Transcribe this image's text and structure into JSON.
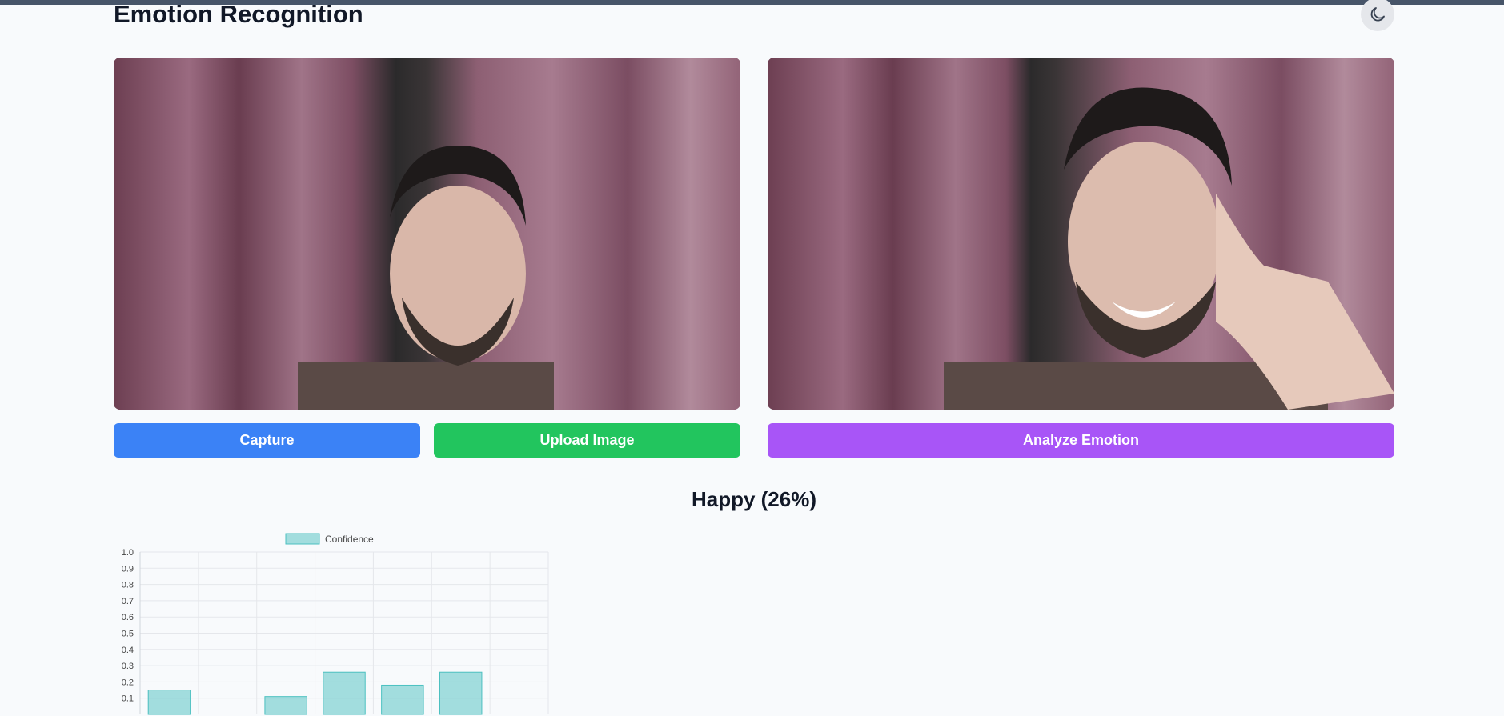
{
  "app": {
    "title": "Emotion Recognition",
    "theme_toggle_icon": "moon-icon"
  },
  "panels": {
    "left": {
      "icon": "webcam-feed"
    },
    "right": {
      "icon": "captured-image"
    }
  },
  "buttons": {
    "capture": "Capture",
    "upload": "Upload Image",
    "analyze": "Analyze Emotion"
  },
  "colors": {
    "capture": "#3b82f6",
    "upload": "#22c55e",
    "analyze": "#a855f7",
    "bar_fill": "rgba(75,192,192,0.5)",
    "bar_stroke": "#4bc0c0"
  },
  "result": {
    "label": "Happy (26%)"
  },
  "chart_data": {
    "type": "bar",
    "legend": "Confidence",
    "categories": [
      "",
      "",
      "",
      "",
      "",
      "",
      ""
    ],
    "values": [
      0.15,
      0.0,
      0.11,
      0.26,
      0.18,
      0.26,
      0.0
    ],
    "ylim": [
      0,
      1.0
    ],
    "yticks": [
      "1.0",
      "0.9",
      "0.8",
      "0.7",
      "0.6",
      "0.5",
      "0.4",
      "0.3",
      "0.2",
      "0.1"
    ],
    "grid": true,
    "legend_position": "top"
  }
}
